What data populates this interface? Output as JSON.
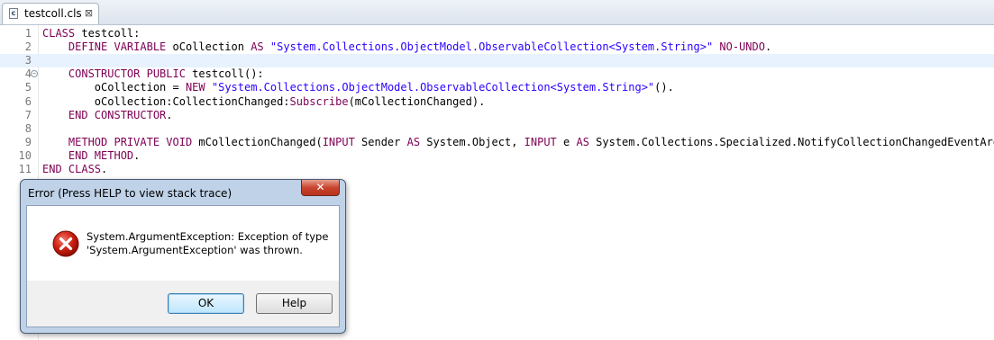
{
  "tab": {
    "label": "testcoll.cls",
    "icon": "class-file-icon",
    "file_icon_letter": "c",
    "close_glyph": "⊠"
  },
  "editor": {
    "lines": [
      {
        "num": "1",
        "tokens": [
          [
            "kw",
            "CLASS"
          ],
          [
            "id",
            " testcoll:"
          ]
        ]
      },
      {
        "num": "2",
        "tokens": [
          [
            "id",
            "    "
          ],
          [
            "kw",
            "DEFINE VARIABLE"
          ],
          [
            "id",
            " oCollection "
          ],
          [
            "kw",
            "AS"
          ],
          [
            "id",
            " "
          ],
          [
            "str",
            "\"System.Collections.ObjectModel.ObservableCollection<System.String>\""
          ],
          [
            "id",
            " "
          ],
          [
            "kw",
            "NO-UNDO"
          ],
          [
            "id",
            "."
          ]
        ]
      },
      {
        "num": "3",
        "tokens": []
      },
      {
        "num": "4",
        "tokens": [
          [
            "id",
            "    "
          ],
          [
            "kw",
            "CONSTRUCTOR PUBLIC"
          ],
          [
            "id",
            " testcoll():"
          ]
        ],
        "fold": true
      },
      {
        "num": "5",
        "tokens": [
          [
            "id",
            "        oCollection = "
          ],
          [
            "kw",
            "NEW"
          ],
          [
            "id",
            " "
          ],
          [
            "str",
            "\"System.Collections.ObjectModel.ObservableCollection<System.String>\""
          ],
          [
            "id",
            "()."
          ]
        ]
      },
      {
        "num": "6",
        "tokens": [
          [
            "id",
            "        oCollection:CollectionChanged:"
          ],
          [
            "kw",
            "Subscribe"
          ],
          [
            "id",
            "(mCollectionChanged)."
          ]
        ]
      },
      {
        "num": "7",
        "tokens": [
          [
            "id",
            "    "
          ],
          [
            "kw",
            "END CONSTRUCTOR"
          ],
          [
            "id",
            "."
          ]
        ]
      },
      {
        "num": "8",
        "tokens": []
      },
      {
        "num": "9",
        "tokens": [
          [
            "id",
            "    "
          ],
          [
            "kw",
            "METHOD PRIVATE VOID"
          ],
          [
            "id",
            " mCollectionChanged("
          ],
          [
            "kw",
            "INPUT"
          ],
          [
            "id",
            " Sender "
          ],
          [
            "kw",
            "AS"
          ],
          [
            "id",
            " System.Object, "
          ],
          [
            "kw",
            "INPUT"
          ],
          [
            "id",
            " e "
          ],
          [
            "kw",
            "AS"
          ],
          [
            "id",
            " System.Collections.Specialized.NotifyCollectionChangedEventArgs):"
          ]
        ]
      },
      {
        "num": "10",
        "tokens": [
          [
            "id",
            "    "
          ],
          [
            "kw",
            "END METHOD"
          ],
          [
            "id",
            "."
          ]
        ]
      },
      {
        "num": "11",
        "tokens": [
          [
            "kw",
            "END CLASS"
          ],
          [
            "id",
            "."
          ]
        ]
      }
    ],
    "current_line": "3",
    "colors": {
      "keyword": "#7f0055",
      "string": "#2a00ff",
      "current_line_bg": "#e8f2fe"
    }
  },
  "dialog": {
    "title": "Error (Press HELP to view stack trace)",
    "close_label": "✕",
    "icon": "error-icon",
    "message_line1": "System.ArgumentException: Exception of type",
    "message_line2": "'System.ArgumentException' was thrown.",
    "ok_label": "OK",
    "help_label": "Help"
  }
}
